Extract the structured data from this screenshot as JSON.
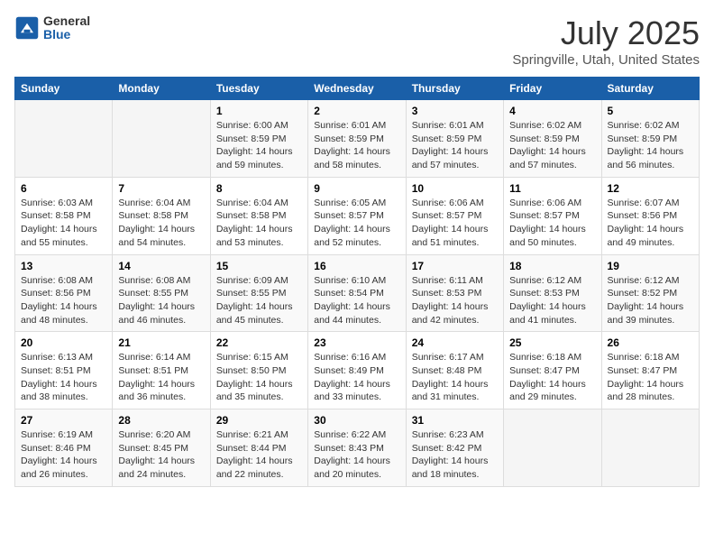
{
  "header": {
    "logo_general": "General",
    "logo_blue": "Blue",
    "title": "July 2025",
    "subtitle": "Springville, Utah, United States"
  },
  "days_of_week": [
    "Sunday",
    "Monday",
    "Tuesday",
    "Wednesday",
    "Thursday",
    "Friday",
    "Saturday"
  ],
  "weeks": [
    [
      {
        "day": "",
        "sunrise": "",
        "sunset": "",
        "daylight": ""
      },
      {
        "day": "",
        "sunrise": "",
        "sunset": "",
        "daylight": ""
      },
      {
        "day": "1",
        "sunrise": "Sunrise: 6:00 AM",
        "sunset": "Sunset: 8:59 PM",
        "daylight": "Daylight: 14 hours and 59 minutes."
      },
      {
        "day": "2",
        "sunrise": "Sunrise: 6:01 AM",
        "sunset": "Sunset: 8:59 PM",
        "daylight": "Daylight: 14 hours and 58 minutes."
      },
      {
        "day": "3",
        "sunrise": "Sunrise: 6:01 AM",
        "sunset": "Sunset: 8:59 PM",
        "daylight": "Daylight: 14 hours and 57 minutes."
      },
      {
        "day": "4",
        "sunrise": "Sunrise: 6:02 AM",
        "sunset": "Sunset: 8:59 PM",
        "daylight": "Daylight: 14 hours and 57 minutes."
      },
      {
        "day": "5",
        "sunrise": "Sunrise: 6:02 AM",
        "sunset": "Sunset: 8:59 PM",
        "daylight": "Daylight: 14 hours and 56 minutes."
      }
    ],
    [
      {
        "day": "6",
        "sunrise": "Sunrise: 6:03 AM",
        "sunset": "Sunset: 8:58 PM",
        "daylight": "Daylight: 14 hours and 55 minutes."
      },
      {
        "day": "7",
        "sunrise": "Sunrise: 6:04 AM",
        "sunset": "Sunset: 8:58 PM",
        "daylight": "Daylight: 14 hours and 54 minutes."
      },
      {
        "day": "8",
        "sunrise": "Sunrise: 6:04 AM",
        "sunset": "Sunset: 8:58 PM",
        "daylight": "Daylight: 14 hours and 53 minutes."
      },
      {
        "day": "9",
        "sunrise": "Sunrise: 6:05 AM",
        "sunset": "Sunset: 8:57 PM",
        "daylight": "Daylight: 14 hours and 52 minutes."
      },
      {
        "day": "10",
        "sunrise": "Sunrise: 6:06 AM",
        "sunset": "Sunset: 8:57 PM",
        "daylight": "Daylight: 14 hours and 51 minutes."
      },
      {
        "day": "11",
        "sunrise": "Sunrise: 6:06 AM",
        "sunset": "Sunset: 8:57 PM",
        "daylight": "Daylight: 14 hours and 50 minutes."
      },
      {
        "day": "12",
        "sunrise": "Sunrise: 6:07 AM",
        "sunset": "Sunset: 8:56 PM",
        "daylight": "Daylight: 14 hours and 49 minutes."
      }
    ],
    [
      {
        "day": "13",
        "sunrise": "Sunrise: 6:08 AM",
        "sunset": "Sunset: 8:56 PM",
        "daylight": "Daylight: 14 hours and 48 minutes."
      },
      {
        "day": "14",
        "sunrise": "Sunrise: 6:08 AM",
        "sunset": "Sunset: 8:55 PM",
        "daylight": "Daylight: 14 hours and 46 minutes."
      },
      {
        "day": "15",
        "sunrise": "Sunrise: 6:09 AM",
        "sunset": "Sunset: 8:55 PM",
        "daylight": "Daylight: 14 hours and 45 minutes."
      },
      {
        "day": "16",
        "sunrise": "Sunrise: 6:10 AM",
        "sunset": "Sunset: 8:54 PM",
        "daylight": "Daylight: 14 hours and 44 minutes."
      },
      {
        "day": "17",
        "sunrise": "Sunrise: 6:11 AM",
        "sunset": "Sunset: 8:53 PM",
        "daylight": "Daylight: 14 hours and 42 minutes."
      },
      {
        "day": "18",
        "sunrise": "Sunrise: 6:12 AM",
        "sunset": "Sunset: 8:53 PM",
        "daylight": "Daylight: 14 hours and 41 minutes."
      },
      {
        "day": "19",
        "sunrise": "Sunrise: 6:12 AM",
        "sunset": "Sunset: 8:52 PM",
        "daylight": "Daylight: 14 hours and 39 minutes."
      }
    ],
    [
      {
        "day": "20",
        "sunrise": "Sunrise: 6:13 AM",
        "sunset": "Sunset: 8:51 PM",
        "daylight": "Daylight: 14 hours and 38 minutes."
      },
      {
        "day": "21",
        "sunrise": "Sunrise: 6:14 AM",
        "sunset": "Sunset: 8:51 PM",
        "daylight": "Daylight: 14 hours and 36 minutes."
      },
      {
        "day": "22",
        "sunrise": "Sunrise: 6:15 AM",
        "sunset": "Sunset: 8:50 PM",
        "daylight": "Daylight: 14 hours and 35 minutes."
      },
      {
        "day": "23",
        "sunrise": "Sunrise: 6:16 AM",
        "sunset": "Sunset: 8:49 PM",
        "daylight": "Daylight: 14 hours and 33 minutes."
      },
      {
        "day": "24",
        "sunrise": "Sunrise: 6:17 AM",
        "sunset": "Sunset: 8:48 PM",
        "daylight": "Daylight: 14 hours and 31 minutes."
      },
      {
        "day": "25",
        "sunrise": "Sunrise: 6:18 AM",
        "sunset": "Sunset: 8:47 PM",
        "daylight": "Daylight: 14 hours and 29 minutes."
      },
      {
        "day": "26",
        "sunrise": "Sunrise: 6:18 AM",
        "sunset": "Sunset: 8:47 PM",
        "daylight": "Daylight: 14 hours and 28 minutes."
      }
    ],
    [
      {
        "day": "27",
        "sunrise": "Sunrise: 6:19 AM",
        "sunset": "Sunset: 8:46 PM",
        "daylight": "Daylight: 14 hours and 26 minutes."
      },
      {
        "day": "28",
        "sunrise": "Sunrise: 6:20 AM",
        "sunset": "Sunset: 8:45 PM",
        "daylight": "Daylight: 14 hours and 24 minutes."
      },
      {
        "day": "29",
        "sunrise": "Sunrise: 6:21 AM",
        "sunset": "Sunset: 8:44 PM",
        "daylight": "Daylight: 14 hours and 22 minutes."
      },
      {
        "day": "30",
        "sunrise": "Sunrise: 6:22 AM",
        "sunset": "Sunset: 8:43 PM",
        "daylight": "Daylight: 14 hours and 20 minutes."
      },
      {
        "day": "31",
        "sunrise": "Sunrise: 6:23 AM",
        "sunset": "Sunset: 8:42 PM",
        "daylight": "Daylight: 14 hours and 18 minutes."
      },
      {
        "day": "",
        "sunrise": "",
        "sunset": "",
        "daylight": ""
      },
      {
        "day": "",
        "sunrise": "",
        "sunset": "",
        "daylight": ""
      }
    ]
  ]
}
